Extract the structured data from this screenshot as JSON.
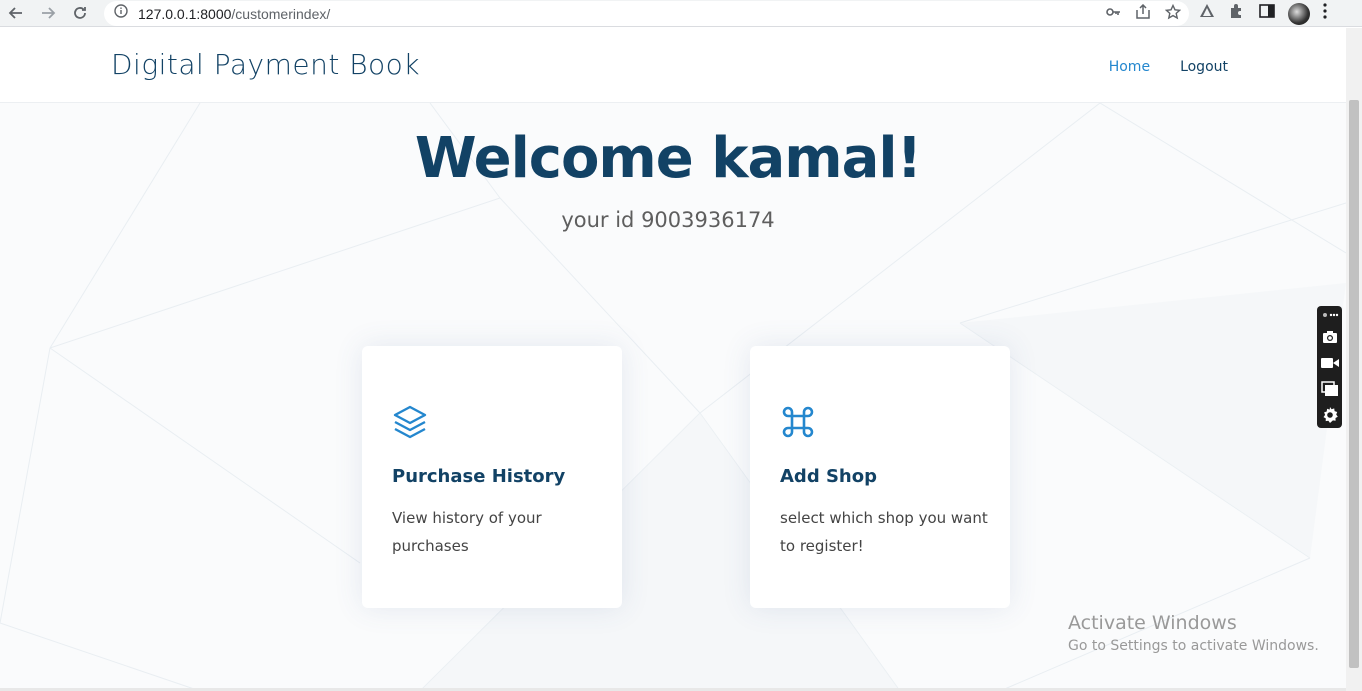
{
  "browser": {
    "url_host": "127.0.0.1:8000",
    "url_path": "/customerindex/"
  },
  "header": {
    "logo": "Digital Payment Book",
    "nav": [
      {
        "label": "Home",
        "active": true
      },
      {
        "label": "Logout",
        "active": false
      }
    ]
  },
  "hero": {
    "title": "Welcome kamal!",
    "subtitle": "your id 9003936174"
  },
  "cards": [
    {
      "title": "Purchase History",
      "description": "View history of your purchases",
      "icon": "layers-icon"
    },
    {
      "title": "Add Shop",
      "description": "select which shop you want to register!",
      "icon": "command-icon"
    }
  ],
  "watermark": {
    "line1": "Activate Windows",
    "line2": "Go to Settings to activate Windows."
  },
  "colors": {
    "brand": "#124265",
    "accent": "#2487ce"
  }
}
